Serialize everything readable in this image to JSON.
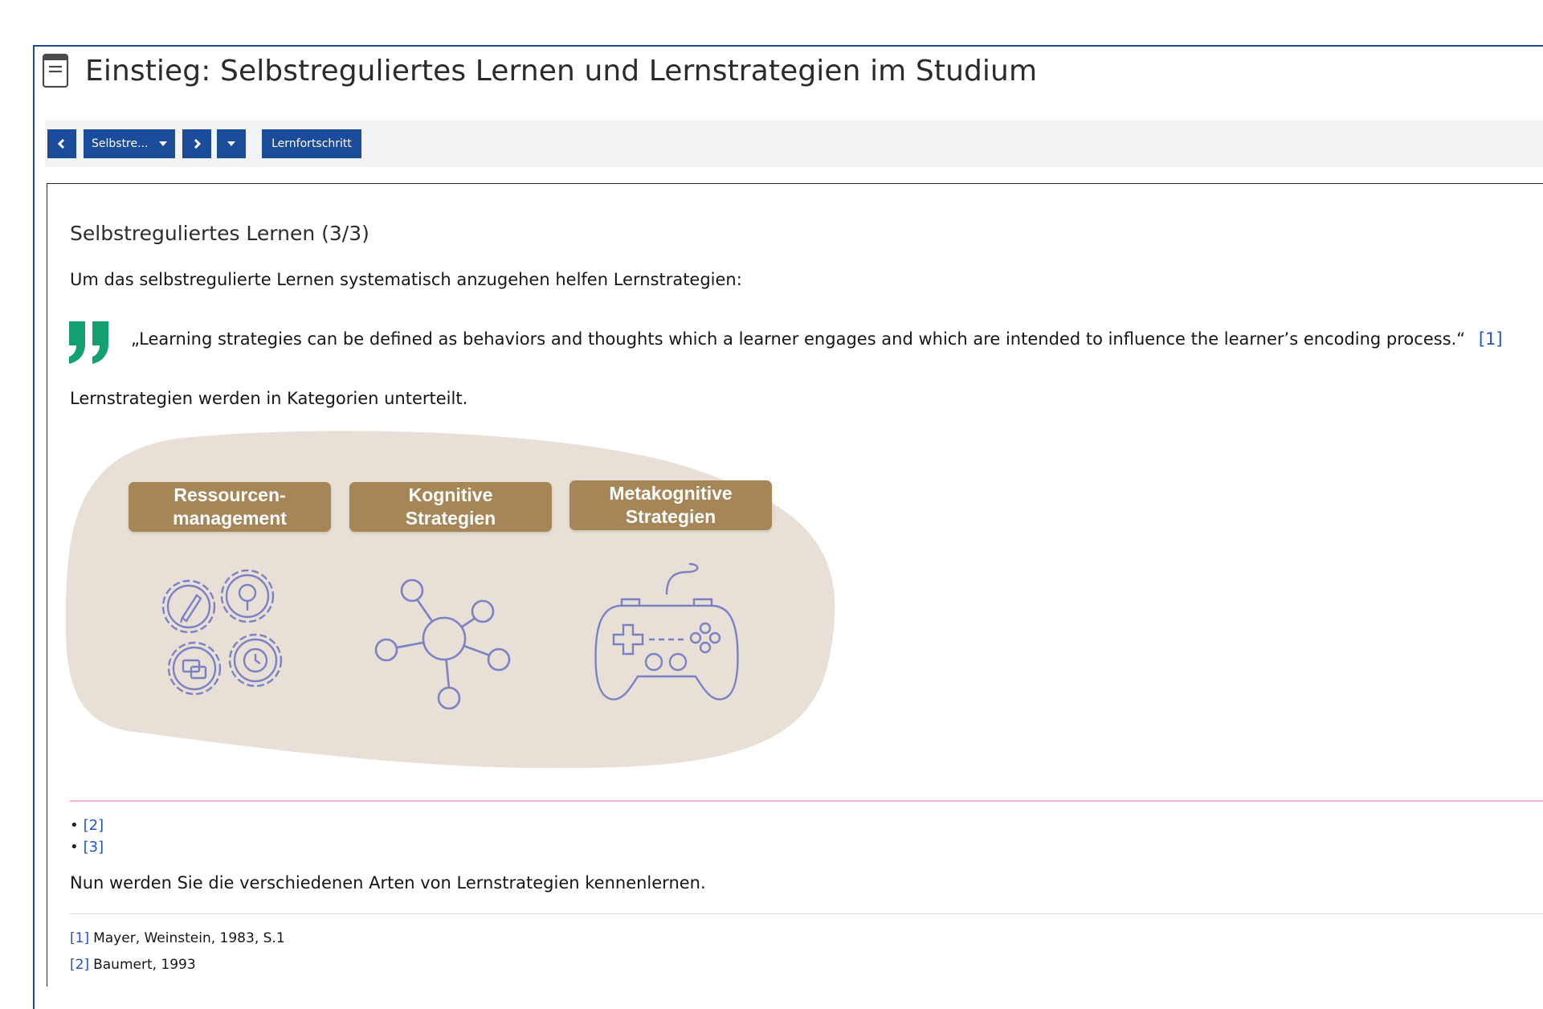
{
  "header": {
    "title": "Einstieg: Selbstreguliertes Lernen und Lernstrategien im Studium",
    "icon": "document-icon"
  },
  "toolbar": {
    "chapter_dropdown_label": "Selbstre...",
    "progress_label": "Lernfortschritt",
    "accent": "#1b4c9c"
  },
  "content": {
    "section_title": "Selbstreguliertes Lernen (3/3)",
    "intro_text": "Um das selbstregulierte Lernen systematisch anzugehen helfen Lernstrategien:",
    "quote": {
      "text": "„Learning strategies can be defined as behaviors and thoughts which a learner engages and which are intended to influence the learner’s encoding process.“",
      "ref": "[1]",
      "mark_color": "#14a06f"
    },
    "categories_text": "Lernstrategien werden in Kategorien unterteilt.",
    "diagram": {
      "background": "#e8e0d6",
      "label_color": "#a68557",
      "icon_color": "#7b82c4",
      "categories": [
        {
          "label": "Ressourcen-\nmanagement",
          "icon": "gears-icon"
        },
        {
          "label": "Kognitive\nStrategien",
          "icon": "network-icon"
        },
        {
          "label": "Metakognitive\nStrategien",
          "icon": "gamepad-icon"
        }
      ]
    },
    "bullet_refs": [
      "[2]",
      "[3]"
    ],
    "closing_text": "Nun werden Sie die verschiedenen Arten von Lernstrategien kennenlernen.",
    "footnotes": [
      {
        "ref": "[1]",
        "text": "Mayer, Weinstein, 1983, S.1"
      },
      {
        "ref": "[2]",
        "text": "Baumert, 1993"
      }
    ]
  }
}
